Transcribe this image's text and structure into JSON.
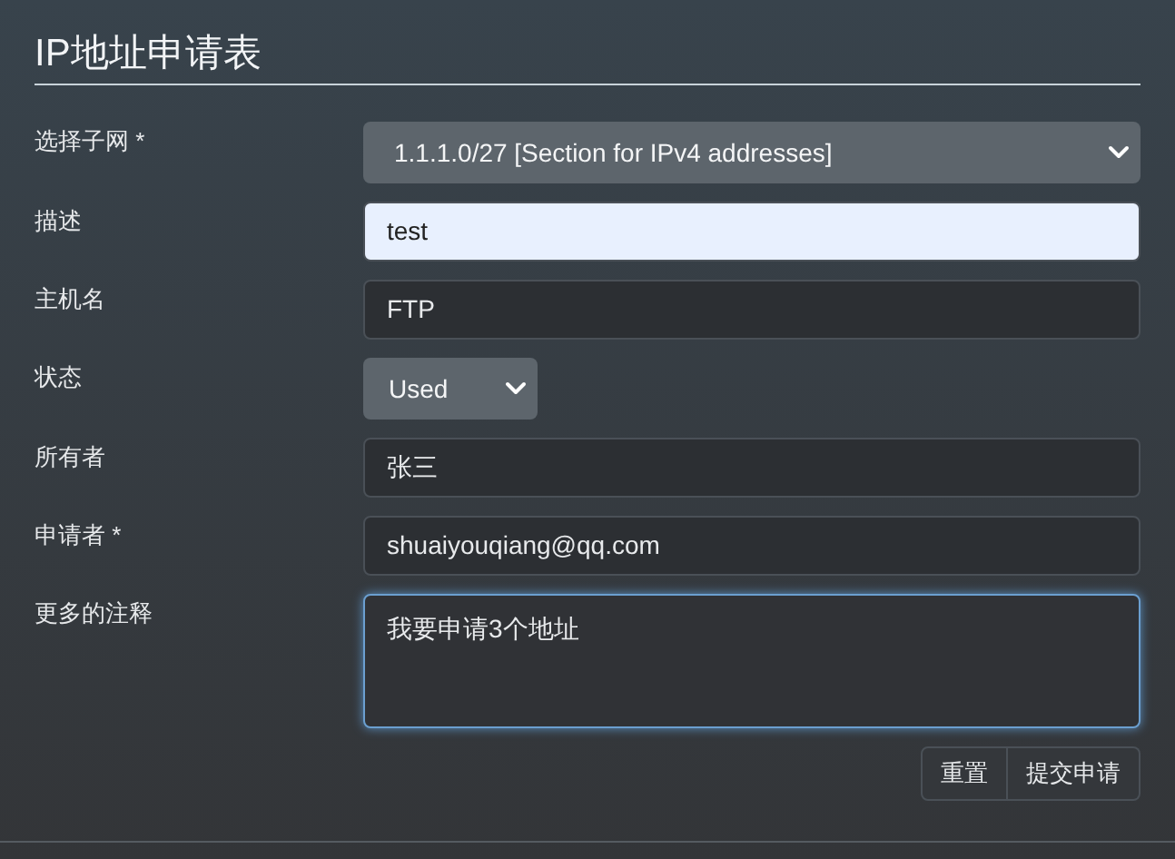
{
  "title": "IP地址申请表",
  "fields": [
    {
      "label": "选择子网 *",
      "kind": "select",
      "value": "1.1.1.0/27 [Section for IPv4 addresses]"
    },
    {
      "label": "描述",
      "kind": "text",
      "value": "test",
      "autofilled": true,
      "focused": false
    },
    {
      "label": "主机名",
      "kind": "text",
      "value": "FTP",
      "autofilled": false,
      "focused": false
    },
    {
      "label": "状态",
      "kind": "dropdown",
      "value": "Used"
    },
    {
      "label": "所有者",
      "kind": "text",
      "value": "张三",
      "autofilled": false,
      "focused": false
    },
    {
      "label": "申请者 *",
      "kind": "text",
      "value": "shuaiyouqiang@qq.com",
      "autofilled": false,
      "focused": false
    },
    {
      "label": "更多的注释",
      "kind": "textarea",
      "value": "我要申请3个地址",
      "autofilled": false,
      "focused": true
    }
  ],
  "buttons": [
    "重置",
    "提交申请"
  ]
}
